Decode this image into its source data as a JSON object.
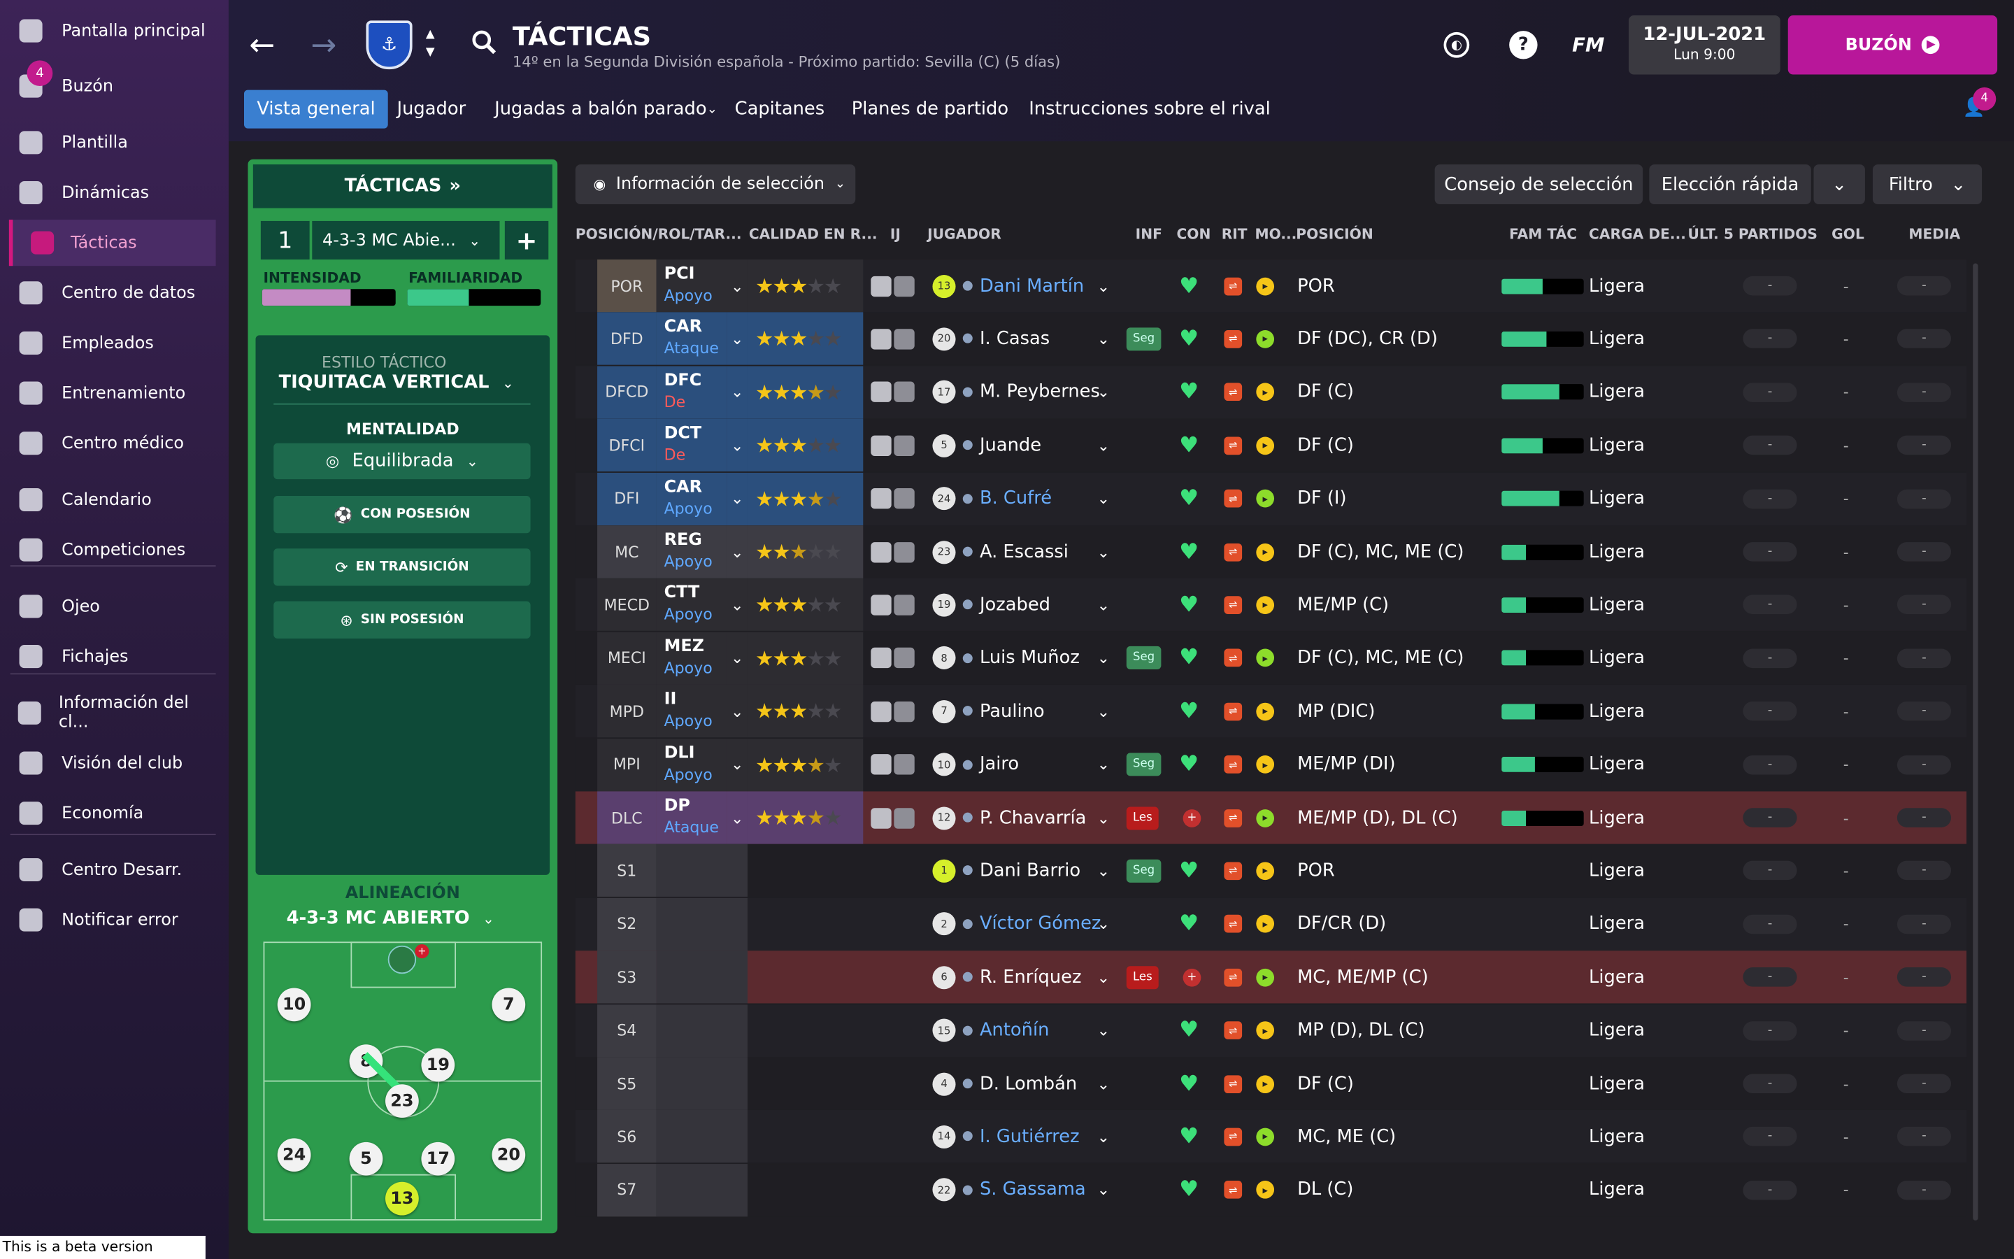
{
  "sidebar": {
    "items": [
      {
        "label": "Pantalla principal",
        "icon": "home-icon"
      },
      {
        "label": "Buzón",
        "icon": "inbox-icon",
        "badge": "4"
      },
      {
        "label": "Plantilla",
        "icon": "squad-icon"
      },
      {
        "label": "Dinámicas",
        "icon": "dynamics-icon"
      },
      {
        "label": "Tácticas",
        "icon": "tactics-icon",
        "active": true
      },
      {
        "label": "Centro de datos",
        "icon": "data-icon"
      },
      {
        "label": "Empleados",
        "icon": "staff-icon"
      },
      {
        "label": "Entrenamiento",
        "icon": "training-icon"
      },
      {
        "label": "Centro médico",
        "icon": "medical-icon"
      },
      {
        "label": "Calendario",
        "icon": "calendar-icon"
      },
      {
        "label": "Competiciones",
        "icon": "trophy-icon"
      },
      {
        "label": "Ojeo",
        "icon": "scouting-icon"
      },
      {
        "label": "Fichajes",
        "icon": "transfers-icon"
      },
      {
        "label": "Información del cl...",
        "icon": "club-info-icon"
      },
      {
        "label": "Visión del club",
        "icon": "club-vision-icon"
      },
      {
        "label": "Economía",
        "icon": "finances-icon"
      },
      {
        "label": "Centro Desarr.",
        "icon": "dev-centre-icon"
      },
      {
        "label": "Notificar error",
        "icon": "report-bug-icon"
      }
    ]
  },
  "header": {
    "title": "TÁCTICAS",
    "subtitle": "14º en la Segunda División española - Próximo partido: Sevilla (C)  (5 días)",
    "date": "12-JUL-2021",
    "time": "Lun 9:00",
    "inbox_button": "BUZÓN",
    "fm_label": "FM",
    "help": "?",
    "notif_badge": "4"
  },
  "tabs": [
    "Vista general",
    "Jugador",
    "Jugadas a balón parado",
    "Capitanes",
    "Planes de partido",
    "Instrucciones sobre el rival"
  ],
  "toolbar": {
    "selection_info": "Información de selección",
    "selection_advice": "Consejo de selección",
    "quick_pick": "Elección rápida",
    "filter": "Filtro"
  },
  "tactics_panel": {
    "title": "TÁCTICAS",
    "slot": "1",
    "formation_select": "4-3-3 MC Abie...",
    "plus": "+",
    "intensity_label": "INTENSIDAD",
    "familiarity_label": "FAMILIARIDAD",
    "intensity_level": 0.66,
    "familiarity_level": 0.46,
    "style_label": "ESTILO TÁCTICO",
    "style_value": "TIQUITACA VERTICAL",
    "mentality_label": "MENTALIDAD",
    "mentality_value": "Equilibrada",
    "buttons": [
      "CON POSESIÓN",
      "EN TRANSICIÓN",
      "SIN POSESIÓN"
    ],
    "lineup_label": "ALINEACIÓN",
    "lineup_value": "4-3-3 MC ABIERTO"
  },
  "pitch_numbers": {
    "gk": "13",
    "lw": "10",
    "rw": "7",
    "lcm": "8",
    "rcm": "19",
    "dm": "23",
    "lb": "24",
    "lcb": "5",
    "rcb": "17",
    "rb": "20"
  },
  "columns": [
    "POSICIÓN/ROL/TAR...",
    "CALIDAD EN R...",
    "IJ",
    "JUGADOR",
    "INF",
    "CON",
    "RIT",
    "MO...",
    "POSICIÓN",
    "FAM TÁC",
    "CARGA DE...",
    "ÚLT. 5 PARTIDOS",
    "GOL",
    "MEDIA"
  ],
  "rows": [
    {
      "pos": "POR",
      "role": "PCI",
      "duty": "Apoyo",
      "duty_color": "#5fa8ff",
      "stars": 3,
      "half": false,
      "num": "13",
      "gk": true,
      "name": "Dani Martín",
      "link": true,
      "inf": "",
      "posn": "POR",
      "fam": 0.5,
      "load": "Ligera",
      "posc": "#5a5048",
      "role_c": "#2d2c31"
    },
    {
      "pos": "DFD",
      "role": "CAR",
      "duty": "Ataque",
      "duty_color": "#5fa8ff",
      "stars": 3,
      "half": false,
      "num": "20",
      "name": "I. Casas",
      "link": false,
      "inf": "Seg",
      "posn": "DF (DC), CR (D)",
      "fam": 0.55,
      "load": "Ligera",
      "posc": "#2b4f7d",
      "role_c": "#2b4f7d"
    },
    {
      "pos": "DFCD",
      "role": "DFC",
      "duty": "De",
      "duty_color": "#ff5a5a",
      "stars": 3.5,
      "half": true,
      "num": "17",
      "name": "M. Peybernes",
      "link": false,
      "inf": "",
      "posn": "DF (C)",
      "fam": 0.7,
      "load": "Ligera",
      "posc": "#2b4f7d",
      "role_c": "#2b4f7d"
    },
    {
      "pos": "DFCI",
      "role": "DCT",
      "duty": "De",
      "duty_color": "#ff5a5a",
      "stars": 3,
      "half": false,
      "num": "5",
      "name": "Juande",
      "link": false,
      "inf": "",
      "posn": "DF (C)",
      "fam": 0.5,
      "load": "Ligera",
      "posc": "#2b4f7d",
      "role_c": "#2b4f7d"
    },
    {
      "pos": "DFI",
      "role": "CAR",
      "duty": "Apoyo",
      "duty_color": "#5fa8ff",
      "stars": 3.5,
      "half": true,
      "num": "24",
      "name": "B. Cufré",
      "link": true,
      "inf": "",
      "posn": "DF (I)",
      "fam": 0.7,
      "load": "Ligera",
      "posc": "#2b4f7d",
      "role_c": "#2b4f7d"
    },
    {
      "pos": "MC",
      "role": "REG",
      "duty": "Apoyo",
      "duty_color": "#5fa8ff",
      "stars": 2.5,
      "half": true,
      "num": "23",
      "name": "A. Escassi",
      "link": false,
      "inf": "",
      "posn": "DF (C), MC, ME (C)",
      "fam": 0.3,
      "load": "Ligera",
      "posc": "#3d3c44",
      "role_c": "#3d3c44"
    },
    {
      "pos": "MECD",
      "role": "CTT",
      "duty": "Apoyo",
      "duty_color": "#5fa8ff",
      "stars": 3,
      "half": false,
      "num": "19",
      "name": "Jozabed",
      "link": false,
      "inf": "",
      "posn": "ME/MP (C)",
      "fam": 0.3,
      "load": "Ligera",
      "posc": "#2d2c31",
      "role_c": "#2d2c31"
    },
    {
      "pos": "MECI",
      "role": "MEZ",
      "duty": "Apoyo",
      "duty_color": "#5fa8ff",
      "stars": 3,
      "half": false,
      "num": "8",
      "name": "Luis Muñoz",
      "link": false,
      "inf": "Seg",
      "posn": "DF (C), MC, ME (C)",
      "fam": 0.3,
      "load": "Ligera",
      "posc": "#2d2c31",
      "role_c": "#2d2c31"
    },
    {
      "pos": "MPD",
      "role": "II",
      "duty": "Apoyo",
      "duty_color": "#5fa8ff",
      "stars": 3,
      "half": false,
      "num": "7",
      "name": "Paulino",
      "link": false,
      "inf": "",
      "posn": "MP (DIC)",
      "fam": 0.4,
      "load": "Ligera",
      "posc": "#2d2c31",
      "role_c": "#2d2c31"
    },
    {
      "pos": "MPI",
      "role": "DLI",
      "duty": "Apoyo",
      "duty_color": "#5fa8ff",
      "stars": 3.5,
      "half": true,
      "num": "10",
      "name": "Jairo",
      "link": false,
      "inf": "Seg",
      "posn": "ME/MP (DI)",
      "fam": 0.4,
      "load": "Ligera",
      "posc": "#2d2c31",
      "role_c": "#2d2c31"
    },
    {
      "pos": "DLC",
      "role": "DP",
      "duty": "Ataque",
      "duty_color": "#5fa8ff",
      "stars": 3.5,
      "half": true,
      "num": "12",
      "name": "P. Chavarría",
      "link": false,
      "inf": "Les",
      "posn": "ME/MP (D), DL (C)",
      "fam": 0.3,
      "load": "Ligera",
      "posc": "#5a3f6e",
      "role_c": "#5a3f6e",
      "injured": true
    },
    {
      "pos": "S1",
      "role": "",
      "duty": "",
      "stars": 0,
      "num": "1",
      "gk": true,
      "name": "Dani Barrio",
      "link": false,
      "inf": "Seg",
      "posn": "POR",
      "load": "Ligera"
    },
    {
      "pos": "S2",
      "role": "",
      "duty": "",
      "stars": 0,
      "num": "2",
      "name": "Víctor Gómez",
      "link": true,
      "inf": "",
      "posn": "DF/CR (D)",
      "load": "Ligera"
    },
    {
      "pos": "S3",
      "role": "",
      "duty": "",
      "stars": 0,
      "num": "6",
      "name": "R. Enríquez",
      "link": false,
      "inf": "Les",
      "posn": "MC, ME/MP (C)",
      "load": "Ligera",
      "injured": true
    },
    {
      "pos": "S4",
      "role": "",
      "duty": "",
      "stars": 0,
      "num": "15",
      "name": "Antoñín",
      "link": true,
      "inf": "",
      "posn": "MP (D), DL (C)",
      "load": "Ligera"
    },
    {
      "pos": "S5",
      "role": "",
      "duty": "",
      "stars": 0,
      "num": "4",
      "name": "D. Lombán",
      "link": false,
      "inf": "",
      "posn": "DF (C)",
      "load": "Ligera"
    },
    {
      "pos": "S6",
      "role": "",
      "duty": "",
      "stars": 0,
      "num": "14",
      "name": "I. Gutiérrez",
      "link": true,
      "inf": "",
      "posn": "MC, ME (C)",
      "load": "Ligera"
    },
    {
      "pos": "S7",
      "role": "",
      "duty": "",
      "stars": 0,
      "num": "22",
      "name": "S. Gassama",
      "link": true,
      "inf": "",
      "posn": "DL (C)",
      "load": "Ligera"
    }
  ],
  "dash": "-",
  "beta_text": "This is a beta version",
  "colors": {
    "accent": "#c21b8d",
    "tab_active": "#3a7fd0",
    "panel_green": "#2c9b4c",
    "heart": "#3de07a",
    "injury": "#b81c1c"
  }
}
